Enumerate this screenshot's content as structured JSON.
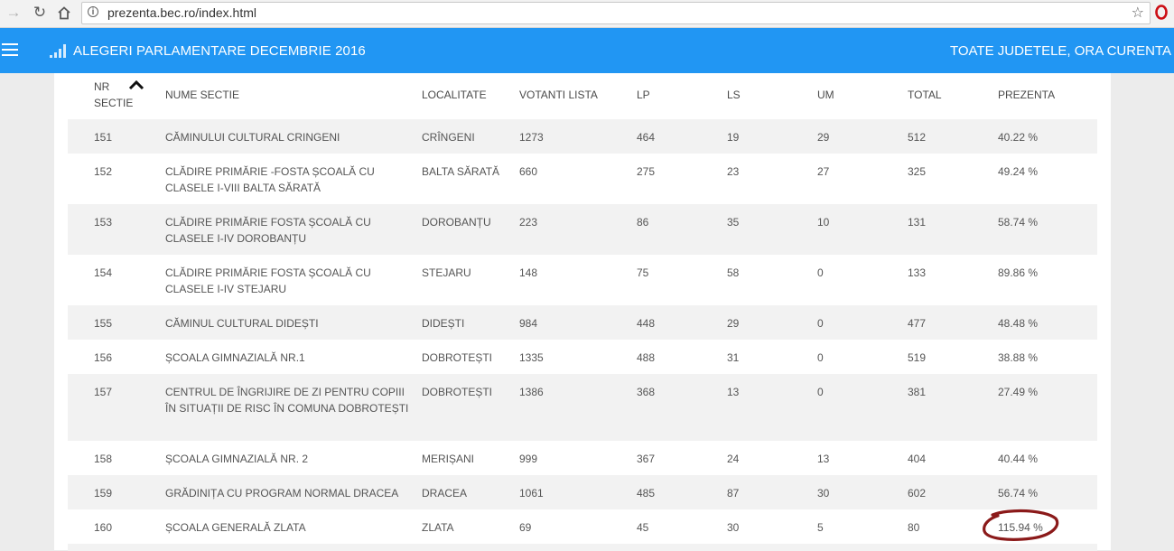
{
  "browser": {
    "url": "prezenta.bec.ro/index.html"
  },
  "header": {
    "title": "ALEGERI PARLAMENTARE DECEMBRIE 2016",
    "right": "TOATE JUDETELE, ORA CURENTA"
  },
  "table": {
    "columns": {
      "nr_line1": "NR",
      "nr_line2": "SECTIE",
      "nume": "NUME SECTIE",
      "localitate": "LOCALITATE",
      "votanti": "VOTANTI LISTA",
      "lp": "LP",
      "ls": "LS",
      "um": "UM",
      "total": "TOTAL",
      "prezenta": "PREZENTA"
    },
    "rows": [
      {
        "nr": "151",
        "nume": "CĂMINULUI CULTURAL CRINGENI",
        "localitate": "CRÎNGENI",
        "votanti": "1273",
        "lp": "464",
        "ls": "19",
        "um": "29",
        "total": "512",
        "prezenta": "40.22 %"
      },
      {
        "nr": "152",
        "nume": "CLĂDIRE PRIMĂRIE -FOSTA ȘCOALĂ CU CLASELE I-VIII BALTA SĂRATĂ",
        "localitate": "BALTA SĂRATĂ",
        "votanti": "660",
        "lp": "275",
        "ls": "23",
        "um": "27",
        "total": "325",
        "prezenta": "49.24 %"
      },
      {
        "nr": "153",
        "nume": "CLĂDIRE PRIMĂRIE FOSTA ȘCOALĂ CU CLASELE I-IV DOROBANȚU",
        "localitate": "DOROBANȚU",
        "votanti": "223",
        "lp": "86",
        "ls": "35",
        "um": "10",
        "total": "131",
        "prezenta": "58.74 %"
      },
      {
        "nr": "154",
        "nume": "CLĂDIRE PRIMĂRIE FOSTA ȘCOALĂ CU CLASELE I-IV STEJARU",
        "localitate": "STEJARU",
        "votanti": "148",
        "lp": "75",
        "ls": "58",
        "um": "0",
        "total": "133",
        "prezenta": "89.86 %"
      },
      {
        "nr": "155",
        "nume": "CĂMINUL CULTURAL DIDEȘTI",
        "localitate": "DIDEȘTI",
        "votanti": "984",
        "lp": "448",
        "ls": "29",
        "um": "0",
        "total": "477",
        "prezenta": "48.48 %"
      },
      {
        "nr": "156",
        "nume": "ȘCOALA GIMNAZIALĂ NR.1",
        "localitate": "DOBROTEȘTI",
        "votanti": "1335",
        "lp": "488",
        "ls": "31",
        "um": "0",
        "total": "519",
        "prezenta": "38.88 %"
      },
      {
        "nr": "157",
        "nume": "CENTRUL DE ÎNGRIJIRE DE ZI PENTRU COPIII ÎN SITUAȚII DE RISC ÎN COMUNA DOBROTEȘTI",
        "localitate": "DOBROTEȘTI",
        "votanti": "1386",
        "lp": "368",
        "ls": "13",
        "um": "0",
        "total": "381",
        "prezenta": "27.49 %"
      },
      {
        "nr": "158",
        "nume": "ȘCOALA GIMNAZIALĂ NR. 2",
        "localitate": "MERIȘANI",
        "votanti": "999",
        "lp": "367",
        "ls": "24",
        "um": "13",
        "total": "404",
        "prezenta": "40.44 %"
      },
      {
        "nr": "159",
        "nume": "GRĂDINIȚA CU PROGRAM NORMAL DRACEA",
        "localitate": "DRACEA",
        "votanti": "1061",
        "lp": "485",
        "ls": "87",
        "um": "30",
        "total": "602",
        "prezenta": "56.74 %"
      },
      {
        "nr": "160",
        "nume": "ȘCOALA GENERALĂ ZLATA",
        "localitate": "ZLATA",
        "votanti": "69",
        "lp": "45",
        "ls": "30",
        "um": "5",
        "total": "80",
        "prezenta": "115.94 %"
      }
    ]
  },
  "colors": {
    "appbar": "#2196f3",
    "stripe": "#f2f2f2",
    "annotation": "#8b1a1a"
  }
}
